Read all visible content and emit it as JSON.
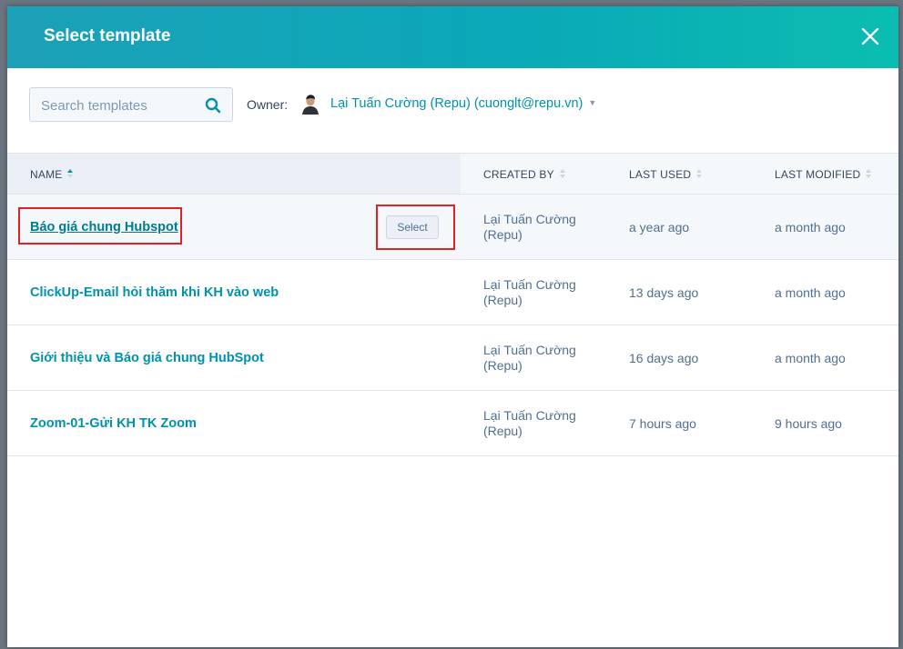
{
  "modal": {
    "title": "Select template"
  },
  "search": {
    "placeholder": "Search templates",
    "value": ""
  },
  "owner": {
    "label": "Owner:",
    "value": "Lại Tuấn Cường (Repu) (cuonglt@repu.vn)"
  },
  "table": {
    "columns": [
      "NAME",
      "CREATED BY",
      "LAST USED",
      "LAST MODIFIED"
    ],
    "select_label": "Select",
    "rows": [
      {
        "name": "Báo giá chung Hubspot",
        "created_by_line1": "Lại Tuấn Cường",
        "created_by_line2": "(Repu)",
        "last_used": "a year ago",
        "last_modified": "a month ago"
      },
      {
        "name": "ClickUp-Email hỏi thăm khi KH vào web",
        "created_by_line1": "Lại Tuấn Cường",
        "created_by_line2": "(Repu)",
        "last_used": "13 days ago",
        "last_modified": "a month ago"
      },
      {
        "name": "Giới thiệu và Báo giá chung HubSpot",
        "created_by_line1": "Lại Tuấn Cường",
        "created_by_line2": "(Repu)",
        "last_used": "16 days ago",
        "last_modified": "a month ago"
      },
      {
        "name": "Zoom-01-Gửi KH TK Zoom",
        "created_by_line1": "Lại Tuấn Cường",
        "created_by_line2": "(Repu)",
        "last_used": "7 hours ago",
        "last_modified": "9 hours ago"
      }
    ]
  },
  "colors": {
    "header_start": "#1ca0b8",
    "header_end": "#0bbdb0",
    "link": "#0091ae",
    "annotation": "#e01f26"
  }
}
